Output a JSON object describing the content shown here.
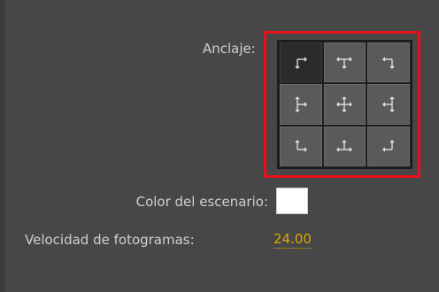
{
  "anchor": {
    "label": "Anclaje:",
    "selected": "top-left",
    "cells": [
      {
        "id": "top-left",
        "icon": "anchor-top-left-icon"
      },
      {
        "id": "top-center",
        "icon": "anchor-top-center-icon"
      },
      {
        "id": "top-right",
        "icon": "anchor-top-right-icon"
      },
      {
        "id": "middle-left",
        "icon": "anchor-middle-left-icon"
      },
      {
        "id": "center",
        "icon": "anchor-center-icon"
      },
      {
        "id": "middle-right",
        "icon": "anchor-middle-right-icon"
      },
      {
        "id": "bottom-left",
        "icon": "anchor-bottom-left-icon"
      },
      {
        "id": "bottom-center",
        "icon": "anchor-bottom-center-icon"
      },
      {
        "id": "bottom-right",
        "icon": "anchor-bottom-right-icon"
      }
    ]
  },
  "stage": {
    "label": "Color del escenario:",
    "color": "#ffffff"
  },
  "frame_rate": {
    "label": "Velocidad de fotogramas:",
    "value": "24.00",
    "value_color": "#e0a800"
  },
  "highlight_color": "#e8101a"
}
